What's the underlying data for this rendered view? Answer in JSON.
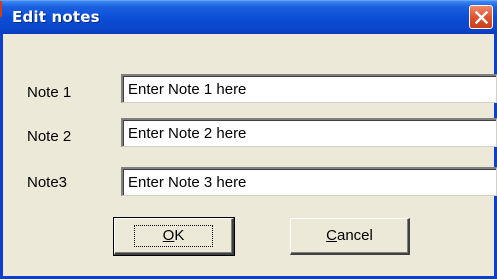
{
  "dialog": {
    "title": "Edit notes",
    "close_icon": "close-icon"
  },
  "fields": [
    {
      "label": "Note 1",
      "value": "Enter Note 1 here"
    },
    {
      "label": "Note 2",
      "value": "Enter Note 2 here"
    },
    {
      "label": "Note3",
      "value": "Enter Note 3 here"
    }
  ],
  "buttons": {
    "ok": {
      "mnemonic": "O",
      "rest": "K"
    },
    "cancel": {
      "mnemonic": "C",
      "rest": "ancel"
    }
  },
  "colors": {
    "titlebar": "#0a4fd6",
    "window_bg": "#ece9d8",
    "close_button": "#e0522d"
  }
}
